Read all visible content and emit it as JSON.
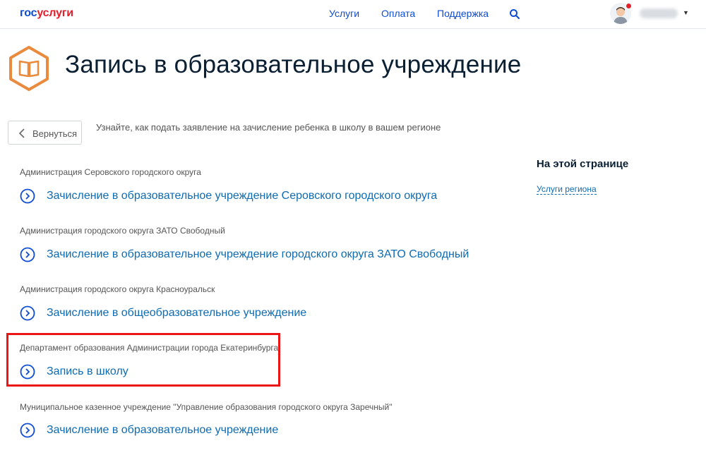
{
  "header": {
    "logo_part1": "гос",
    "logo_part2": "услуги",
    "nav": [
      "Услуги",
      "Оплата",
      "Поддержка"
    ]
  },
  "page": {
    "title": "Запись в образовательное учреждение",
    "back_label": "Вернуться",
    "intro": "Узнайте, как подать заявление на зачисление ребенка в школу в вашем регионе"
  },
  "entries": [
    {
      "org": "Администрация Серовского городского округа",
      "service": "Зачисление в образовательное учреждение Серовского городского округа"
    },
    {
      "org": "Администрация городского округа ЗАТО Свободный",
      "service": "Зачисление в образовательное учреждение городского округа ЗАТО Свободный"
    },
    {
      "org": "Администрация городского округа Красноуральск",
      "service": "Зачисление в общеобразовательное учреждение"
    },
    {
      "org": "Департамент образования Администрации города Екатеринбурга",
      "service": "Запись в школу"
    },
    {
      "org": "Муниципальное казенное учреждение \"Управление образования городского округа Заречный\"",
      "service": "Зачисление в образовательное учреждение"
    }
  ],
  "sidebar": {
    "title": "На этой странице",
    "link": "Услуги региона"
  },
  "colors": {
    "brand_blue": "#0d4cd3",
    "brand_red": "#e2202b",
    "link_blue": "#0d6bb3",
    "icon_orange": "#e98a3c",
    "highlight_red": "#ea1616"
  },
  "icons": [
    "search-icon",
    "user-avatar",
    "chevron-down-icon",
    "book-icon",
    "chevron-left-icon",
    "chevron-right-circle-icon"
  ]
}
